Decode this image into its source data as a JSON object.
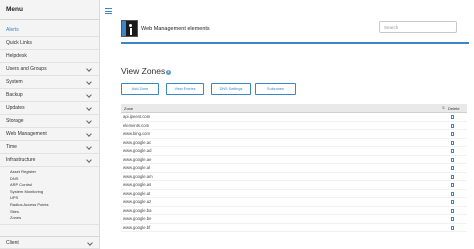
{
  "sidebar": {
    "title": "Menu",
    "items": [
      {
        "label": "Alerts",
        "active": true,
        "has_chevron": false
      },
      {
        "label": "Quick Links",
        "has_chevron": false
      },
      {
        "label": "Helpdesk",
        "has_chevron": false
      },
      {
        "label": "Users and Groups",
        "has_chevron": true
      },
      {
        "label": "System",
        "has_chevron": true
      },
      {
        "label": "Backup",
        "has_chevron": true
      },
      {
        "label": "Updates",
        "has_chevron": true
      },
      {
        "label": "Storage",
        "has_chevron": true
      },
      {
        "label": "Web Management",
        "has_chevron": true
      },
      {
        "label": "Time",
        "has_chevron": true
      },
      {
        "label": "Infrastructure",
        "has_chevron": true,
        "expanded": true
      }
    ],
    "submenu": [
      "Asset Register",
      "DNS",
      "ARP Control",
      "System Monitoring",
      "UPS",
      "Radius Access Points",
      "Sites",
      "Zones"
    ],
    "bottom_item": {
      "label": "Client",
      "has_chevron": true
    }
  },
  "header": {
    "site_title": "Web Management elements",
    "search_placeholder": "Search"
  },
  "page": {
    "title": "View Zones",
    "info_glyph": "i"
  },
  "toolbar": {
    "buttons": [
      "Add Zone",
      "View Entries",
      "DNS Settings",
      "Subzones"
    ]
  },
  "table": {
    "headers": {
      "zone": "Zone",
      "sort_glyph": "⇅",
      "delete": "Delete"
    },
    "rows": [
      "api.ipeent.com",
      "elements.com",
      "www.bing.com",
      "www.google.ac",
      "www.google.ad",
      "www.google.ae",
      "www.google.al",
      "www.google.am",
      "www.google.as",
      "www.google.at",
      "www.google.az",
      "www.google.ba",
      "www.google.be",
      "www.google.bf"
    ]
  },
  "colors": {
    "accent": "#3a86c8",
    "sidebar_bg": "#f4f4f4",
    "table_header_bg": "#e9e9e9"
  }
}
